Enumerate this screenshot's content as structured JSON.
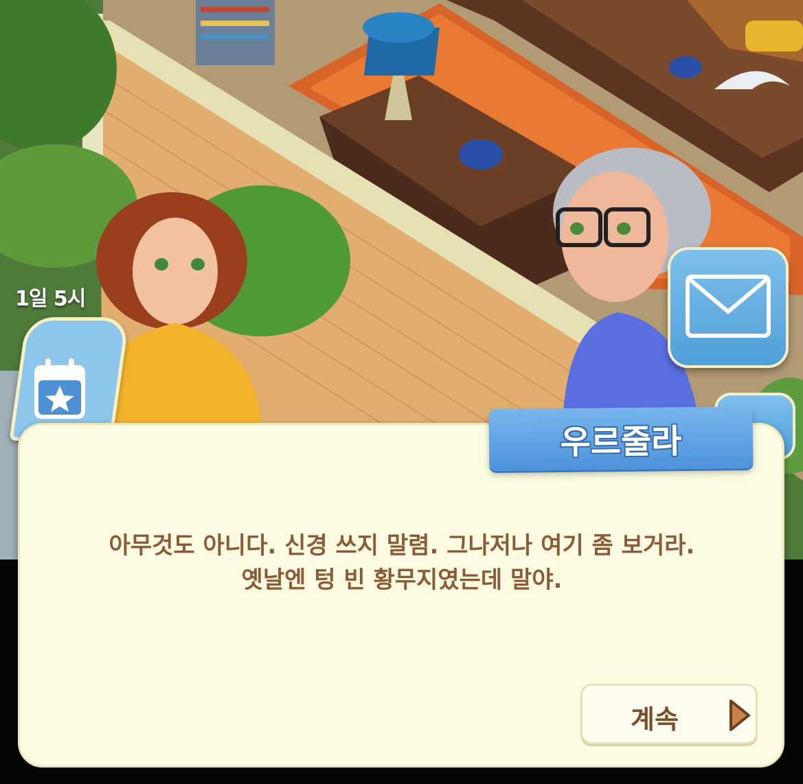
{
  "hud": {
    "timer_text": "1일 5시"
  },
  "dialog": {
    "speaker_name": "우르줄라",
    "line1": "아무것도 아니다. 신경 쓰지 말렴. 그나저나 여기 좀 보거라.",
    "line2": "옛날엔 텅 빈 황무지였는데 말야.",
    "continue_label": "계속"
  },
  "icons": {
    "event": "calendar-star-icon",
    "mail": "envelope-icon",
    "continue": "triangle-right-icon"
  },
  "colors": {
    "dialog_bg": "#fdfce2",
    "dialog_text": "#8a5b36",
    "nameplate": "#5a9fe0",
    "button_blue": "#5fa9e0"
  }
}
